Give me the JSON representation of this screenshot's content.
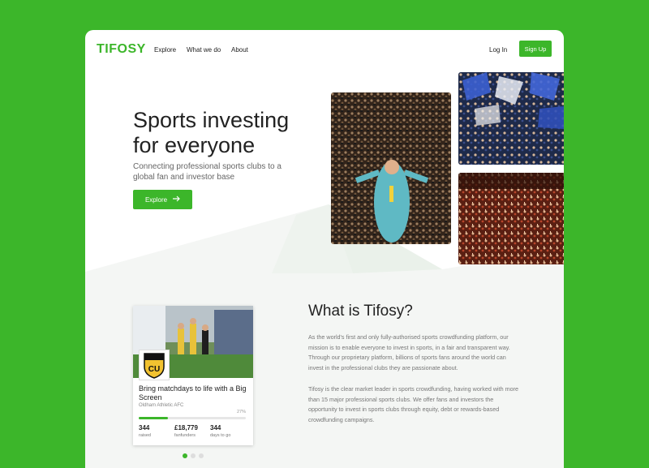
{
  "brand": {
    "logo_text": "TIFOSY",
    "accent": "#3cb62a"
  },
  "nav": {
    "links": [
      {
        "label": "Explore"
      },
      {
        "label": "What we do"
      },
      {
        "label": "About"
      }
    ],
    "login_label": "Log In",
    "signup_label": "Sign Up"
  },
  "hero": {
    "title_line1": "Sports investing",
    "title_line2": "for everyone",
    "subtitle": "Connecting professional sports clubs to a global fan and investor base",
    "button_label": "Explore"
  },
  "campaign": {
    "title": "Bring matchdays to life with a Big Screen",
    "club": "Oldham Athletic AFC",
    "badge_text": "CU",
    "progress_percent": 27,
    "progress_label": "27%",
    "stats": [
      {
        "value": "344",
        "label": "raised"
      },
      {
        "value": "£18,779",
        "label": "fanfunders"
      },
      {
        "value": "344",
        "label": "days to go"
      }
    ]
  },
  "carousel": {
    "active_index": 0,
    "count": 3
  },
  "about": {
    "title": "What is Tifosy?",
    "para1": "As the world's first and only fully-authorised sports crowdfunding platform, our mission is to enable everyone to invest in sports, in a fair and transparent way. Through our proprietary platform, billions of sports fans around the world can invest in the professional clubs they are passionate about.",
    "para2": "Tifosy is the clear market leader in sports crowdfunding, having worked with more than 15 major professional sports clubs. We offer fans and investors the opportunity to invest in sports clubs through equity, debt or rewards-based crowdfunding campaigns."
  }
}
